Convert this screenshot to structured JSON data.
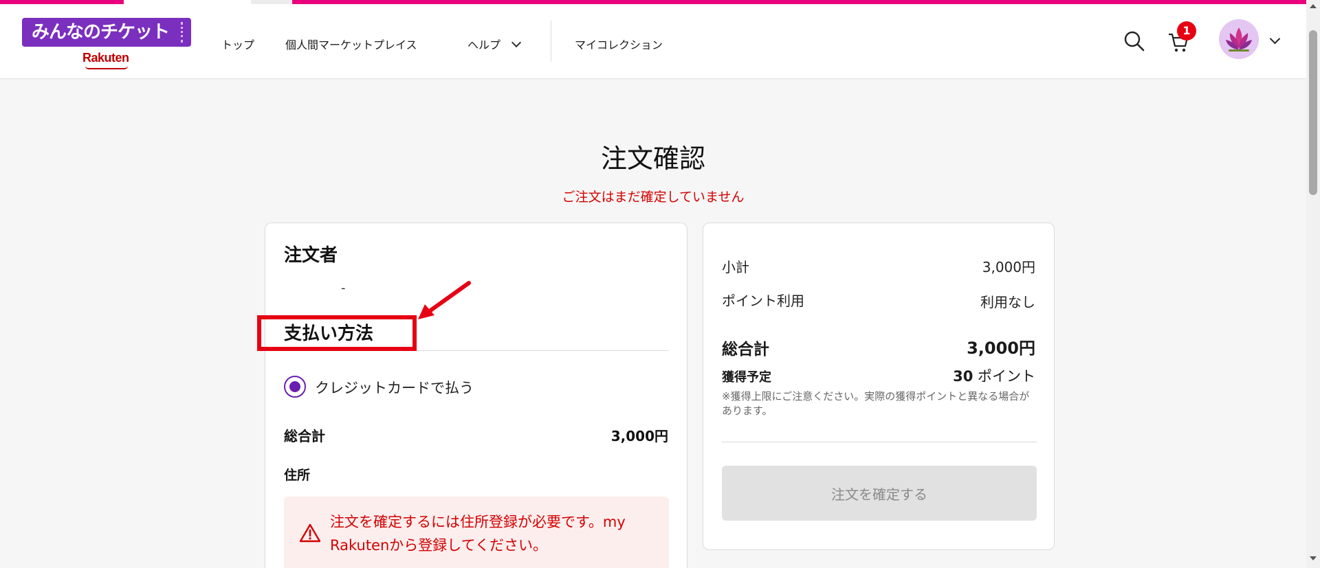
{
  "header": {
    "logo": {
      "title": "みんなのチケット",
      "brand": "Rakuten"
    },
    "nav": [
      {
        "label": "トップ"
      },
      {
        "label": "個人間マーケットプレイス"
      },
      {
        "label": "ヘルプ"
      },
      {
        "label": "マイコレクション"
      }
    ],
    "cart_count": "1",
    "icons": [
      "search-icon",
      "cart-icon",
      "avatar",
      "chevron-down-icon"
    ]
  },
  "page": {
    "title": "注文確認",
    "notice": "ご注文はまだ確定していません"
  },
  "orderer": {
    "heading": "注文者",
    "value": "-"
  },
  "payment": {
    "heading": "支払い方法",
    "option_label": "クレジットカードで払う",
    "selected": true,
    "total_label": "総合計",
    "total_value": "3,000円"
  },
  "address": {
    "heading": "住所",
    "alert": "注文を確定するには住所登録が必要です。my Rakutenから登録してください。"
  },
  "summary": {
    "subtotal_label": "小計",
    "subtotal_value": "3,000円",
    "points_label": "ポイント利用",
    "points_value": "利用なし",
    "total_label": "総合計",
    "total_value": "3,000円",
    "earn_label": "獲得予定",
    "earn_points": "30",
    "earn_unit": "ポイント",
    "note": "※獲得上限にご注意ください。実際の獲得ポイントと異なる場合があります。",
    "confirm_button": "注文を確定する"
  },
  "colors": {
    "brand_purple": "#7b2fbe",
    "accent_pink": "#e8007c",
    "error_red": "#d40000",
    "annotation_red": "#e60012"
  }
}
